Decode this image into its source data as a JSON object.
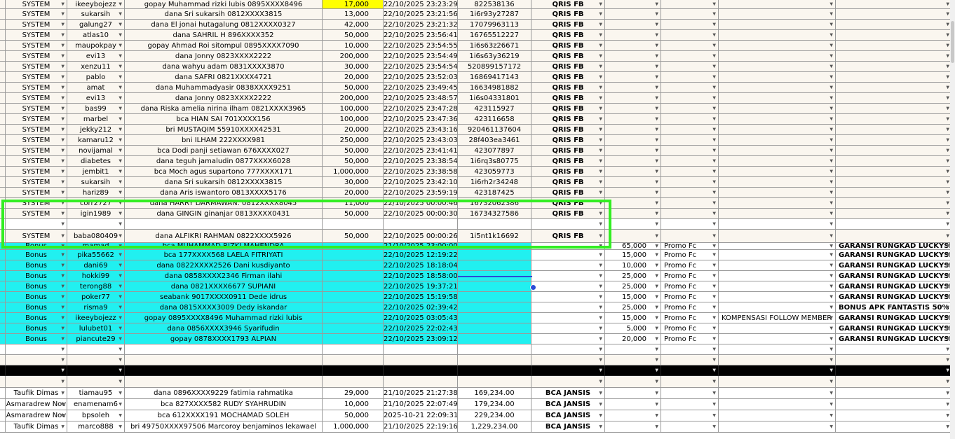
{
  "rows": [
    {
      "style": "cream",
      "h": 13,
      "cells": [
        "SYSTEM",
        "ikeeybojezz",
        "gopay Muhammad rizki lubis 0895XXXX8496",
        "17,000",
        "22/10/2025 23:23:29",
        "822538136",
        "QRIS FB",
        "",
        "",
        "",
        "",
        ""
      ]
    },
    {
      "style": "cream",
      "h": 15,
      "cells": [
        "SYSTEM",
        "sukarsih",
        "dana Sri sukarsih 0812XXXX3815",
        "13,000",
        "22/10/2025 23:21:56",
        "1i6r93y27287",
        "QRIS FB",
        "",
        "",
        "",
        "",
        ""
      ]
    },
    {
      "style": "cream",
      "h": 15,
      "cells": [
        "SYSTEM",
        "galung27",
        "dana El jonai hutagalung 0812XXXX0327",
        "42,000",
        "22/10/2025 23:21:32",
        "17079963113",
        "QRIS FB",
        "",
        "",
        "",
        "",
        ""
      ]
    },
    {
      "style": "cream",
      "h": 15,
      "cells": [
        "SYSTEM",
        "atlas10",
        "dana SAHRIL H 896XXXX352",
        "50,000",
        "22/10/2025 23:56:41",
        "16765512227",
        "QRIS FB",
        "",
        "",
        "",
        "",
        ""
      ]
    },
    {
      "style": "cream",
      "h": 15,
      "cells": [
        "SYSTEM",
        "maupokpay",
        "gopay Ahmad Roi sitompul 0895XXXX7090",
        "10,000",
        "22/10/2025 23:54:55",
        "1i6s63z26671",
        "QRIS FB",
        "",
        "",
        "",
        "",
        ""
      ]
    },
    {
      "style": "cream",
      "h": 15,
      "cells": [
        "SYSTEM",
        "evi13",
        "dana Jonny 0823XXXX2222",
        "200,000",
        "22/10/2025 23:54:49",
        "1i6s63y36219",
        "QRIS FB",
        "",
        "",
        "",
        "",
        ""
      ]
    },
    {
      "style": "cream",
      "h": 15,
      "cells": [
        "SYSTEM",
        "xenzu11",
        "dana wahyu adam 0831XXXX3870",
        "30,000",
        "22/10/2025 23:54:54",
        "520899157172",
        "QRIS FB",
        "",
        "",
        "",
        "",
        ""
      ]
    },
    {
      "style": "cream",
      "h": 15,
      "cells": [
        "SYSTEM",
        "pablo",
        "dana SAFRI 0821XXXX4721",
        "20,000",
        "22/10/2025 23:52:03",
        "16869417143",
        "QRIS FB",
        "",
        "",
        "",
        "",
        ""
      ]
    },
    {
      "style": "cream",
      "h": 15,
      "cells": [
        "SYSTEM",
        "amat",
        "dana Muhammadyasir 0838XXXX9251",
        "50,000",
        "22/10/2025 23:49:45",
        "16634981882",
        "QRIS FB",
        "",
        "",
        "",
        "",
        ""
      ]
    },
    {
      "style": "cream",
      "h": 15,
      "cells": [
        "SYSTEM",
        "evi13",
        "dana Jonny 0823XXXX2222",
        "200,000",
        "22/10/2025 23:48:57",
        "1i6s04331801",
        "QRIS FB",
        "",
        "",
        "",
        "",
        ""
      ]
    },
    {
      "style": "cream",
      "h": 15,
      "cells": [
        "SYSTEM",
        "bas99",
        "dana Riska amelia nirina ilham 0821XXXX3965",
        "100,000",
        "22/10/2025 23:47:28",
        "423115927",
        "QRIS FB",
        "",
        "",
        "",
        "",
        ""
      ]
    },
    {
      "style": "cream",
      "h": 15,
      "cells": [
        "SYSTEM",
        "marbel",
        "bca HIAN SAI 701XXXX156",
        "100,000",
        "22/10/2025 23:47:36",
        "423116658",
        "QRIS FB",
        "",
        "",
        "",
        "",
        ""
      ]
    },
    {
      "style": "cream",
      "h": 15,
      "cells": [
        "SYSTEM",
        "jekky212",
        "bri MUSTAQIM 55910XXXX42531",
        "20,000",
        "22/10/2025 23:43:16",
        "920461137604",
        "QRIS FB",
        "",
        "",
        "",
        "",
        ""
      ]
    },
    {
      "style": "cream",
      "h": 15,
      "cells": [
        "SYSTEM",
        "kamaru12",
        "bni ILHAM 222XXXX981",
        "250,000",
        "22/10/2025 23:43:03",
        "28f403ea3461",
        "QRIS FB",
        "",
        "",
        "",
        "",
        ""
      ]
    },
    {
      "style": "cream",
      "h": 15,
      "cells": [
        "SYSTEM",
        "novijamal",
        "bca Dodi panji setiawan 676XXXX027",
        "50,000",
        "22/10/2025 23:41:41",
        "423077897",
        "QRIS FB",
        "",
        "",
        "",
        "",
        ""
      ]
    },
    {
      "style": "cream",
      "h": 15,
      "cells": [
        "SYSTEM",
        "diabetes",
        "dana teguh jamaludin 0877XXXX6028",
        "50,000",
        "22/10/2025 23:38:54",
        "1i6rq3s80775",
        "QRIS FB",
        "",
        "",
        "",
        "",
        ""
      ]
    },
    {
      "style": "cream",
      "h": 15,
      "cells": [
        "SYSTEM",
        "jembit1",
        "bca Moch agus supartono 777XXXX171",
        "1,000,000",
        "22/10/2025 23:38:58",
        "423059773",
        "QRIS FB",
        "",
        "",
        "",
        "",
        ""
      ]
    },
    {
      "style": "cream",
      "h": 15,
      "cells": [
        "SYSTEM",
        "sukarsih",
        "dana Sri sukarsih 0812XXXX3815",
        "30,000",
        "22/10/2025 23:42:10",
        "1i6rh2r34248",
        "QRIS FB",
        "",
        "",
        "",
        "",
        ""
      ]
    },
    {
      "style": "cream",
      "h": 15,
      "cells": [
        "SYSTEM",
        "hariz89",
        "dana Aris iswantoro 0813XXXX5176",
        "20,000",
        "22/10/2025 23:59:19",
        "423187425",
        "QRIS FB",
        "",
        "",
        "",
        "",
        ""
      ]
    },
    {
      "style": "cream",
      "h": 15,
      "cells": [
        "SYSTEM",
        "corr2727",
        "dana HARRY DARMAWAN. 0812XXXX8045",
        "11,000",
        "22/10/2025 00:00:46",
        "16732062386",
        "QRIS FB",
        "",
        "",
        "",
        "",
        ""
      ]
    },
    {
      "style": "cream",
      "h": 15,
      "cells": [
        "SYSTEM",
        "igin1989",
        "dana GINGIN ginanjar 0813XXXX0431",
        "50,000",
        "22/10/2025 00:00:30",
        "16734327586",
        "QRIS FB",
        "",
        "",
        "",
        "",
        ""
      ]
    },
    {
      "style": "white",
      "h": 15,
      "cells": [
        "",
        "",
        "",
        "",
        "",
        "",
        "",
        "",
        "",
        "",
        "",
        ""
      ]
    },
    {
      "style": "cream",
      "h": 19,
      "cells": [
        "SYSTEM",
        "baba080409",
        "dana ALFIKRI RAHMAN 0822XXXX5926",
        "50,000",
        "22/10/2025 00:00:26",
        "1i5nt1k16692",
        "QRIS FB",
        "",
        "",
        "",
        "",
        ""
      ]
    },
    {
      "style": "cyan",
      "h": 10,
      "cells": [
        "Bonus",
        "mamad",
        "bca MUHAMMAD RIZKI MAHENDRA",
        "",
        "21/10/2025 23:00:00",
        "",
        "",
        "65,000",
        "Promo Fc",
        "",
        "GARANSI RUNGKAD LUCKYSPIN",
        ""
      ]
    },
    {
      "style": "cyan",
      "h": 15,
      "cells": [
        "Bonus",
        "pika55662",
        "bca 177XXXX568 LAELA FITRIYATI",
        "",
        "22/10/2025 12:19:22",
        "",
        "",
        "15,000",
        "Promo Fc",
        "",
        "GARANSI RUNGKAD LUCKYSPIN",
        ""
      ]
    },
    {
      "style": "cyan",
      "h": 15,
      "cells": [
        "Bonus",
        "dani69",
        "dana 0822XXXX2526 Dani kusdiyanto",
        "",
        "22/10/2025 18:18:04",
        "",
        "",
        "10,000",
        "Promo Fc",
        "",
        "GARANSI RUNGKAD LUCKYSPIN",
        ""
      ]
    },
    {
      "style": "cyan",
      "h": 15,
      "cells": [
        "Bonus",
        "hokki99",
        "dana 0858XXXX2346 Firman ilahi",
        "",
        "22/10/2025 18:58:00",
        "",
        "",
        "25,000",
        "Promo Fc",
        "",
        "GARANSI RUNGKAD LUCKYSPIN",
        ""
      ]
    },
    {
      "style": "cyan",
      "h": 15,
      "cells": [
        "Bonus",
        "terong88",
        "dana 0821XXXX6677 SUPIANI",
        "",
        "22/10/2025 19:37:21",
        "",
        "",
        "25,000",
        "Promo Fc",
        "",
        "GARANSI RUNGKAD LUCKYSPIN",
        ""
      ]
    },
    {
      "style": "cyan",
      "h": 15,
      "cells": [
        "Bonus",
        "poker77",
        "seabank 9017XXXX0911 Dede idrus",
        "",
        "22/10/2025 15:19:58",
        "",
        "",
        "15,000",
        "Promo Fc",
        "",
        "GARANSI RUNGKAD LUCKYSPIN",
        ""
      ]
    },
    {
      "style": "cyan",
      "h": 15,
      "cells": [
        "Bonus",
        "risma9",
        "dana 0815XXXX3009 Dedy iskandar",
        "",
        "22/10/2025 02:39:42",
        "",
        "",
        "25,000",
        "Promo Fc",
        "",
        "BONUS APK FANTASTIS 50%",
        ""
      ]
    },
    {
      "style": "cyan",
      "h": 15,
      "cells": [
        "Bonus",
        "ikeeybojezz",
        "gopay 0895XXXX8496 Muhammad rizki lubis",
        "",
        "22/10/2025 03:05:43",
        "",
        "",
        "15,000",
        "Promo Fc",
        "KOMPENSASI FOLLOW MEMBER",
        "GARANSI RUNGKAD LUCKYSPIN",
        ""
      ]
    },
    {
      "style": "cyan",
      "h": 15,
      "cells": [
        "Bonus",
        "lulubet01",
        "dana 0856XXXX3946 Syarifudin",
        "",
        "22/10/2025 22:02:43",
        "",
        "",
        "5,000",
        "Promo Fc",
        "",
        "GARANSI RUNGKAD LUCKYSPIN",
        ""
      ]
    },
    {
      "style": "cyan",
      "h": 15,
      "cells": [
        "Bonus",
        "piancute29",
        "gopay 0878XXXX1793 ALPIAN",
        "",
        "22/10/2025 23:09:12",
        "",
        "",
        "20,000",
        "Promo Fc",
        "",
        "GARANSI RUNGKAD LUCKYSPIN",
        ""
      ]
    },
    {
      "style": "white",
      "h": 15,
      "cells": [
        "",
        "",
        "",
        "",
        "",
        "",
        "",
        "",
        "",
        "",
        "",
        ""
      ]
    },
    {
      "style": "cream",
      "h": 15,
      "cells": [
        "",
        "",
        "",
        "",
        "",
        "",
        "",
        "",
        "",
        "",
        "",
        ""
      ]
    },
    {
      "style": "black",
      "h": 15,
      "cells": [
        "",
        "",
        "",
        "",
        "",
        "",
        "",
        "",
        "",
        "",
        "",
        ""
      ]
    },
    {
      "style": "cream",
      "h": 17,
      "cells": [
        "",
        "",
        "",
        "",
        "",
        "",
        "",
        "",
        "",
        "",
        "",
        ""
      ]
    },
    {
      "style": "white",
      "h": 16,
      "cells": [
        "Taufik Dimas",
        "tiamau95",
        "dana 0896XXXX9229 fatimia rahmatika",
        "29,000",
        "21/10/2025 21:27:38",
        "169,234.00",
        "BCA JANSIS",
        "",
        "",
        "",
        "",
        ""
      ]
    },
    {
      "style": "white",
      "h": 16,
      "cells": [
        "Asmaradrew Nov",
        "enamenam6",
        "bca 827XXXX582 RUDY SYAHRUDIN",
        "10,000",
        "21/10/2025 22:07:49",
        "179,234.00",
        "BCA JANSIS",
        "",
        "",
        "",
        "",
        ""
      ]
    },
    {
      "style": "white",
      "h": 16,
      "cells": [
        "Asmaradrew Nov",
        "bpsoleh",
        "bca 612XXXX191 MOCHAMAD SOLEH",
        "50,000",
        "2025-10-21 22:09:31",
        "229,234.00",
        "BCA JANSIS",
        "",
        "",
        "",
        "",
        ""
      ]
    },
    {
      "style": "white",
      "h": 16,
      "cells": [
        "Taufik Dimas",
        "marco888",
        "bri 49750XXXX97506 Marcoroy benjaminos lekawael",
        "1,000,000",
        "21/10/2025 22:19:16",
        "1,229,234.00",
        "BCA JANSIS",
        "",
        "",
        "",
        "",
        ""
      ]
    }
  ]
}
